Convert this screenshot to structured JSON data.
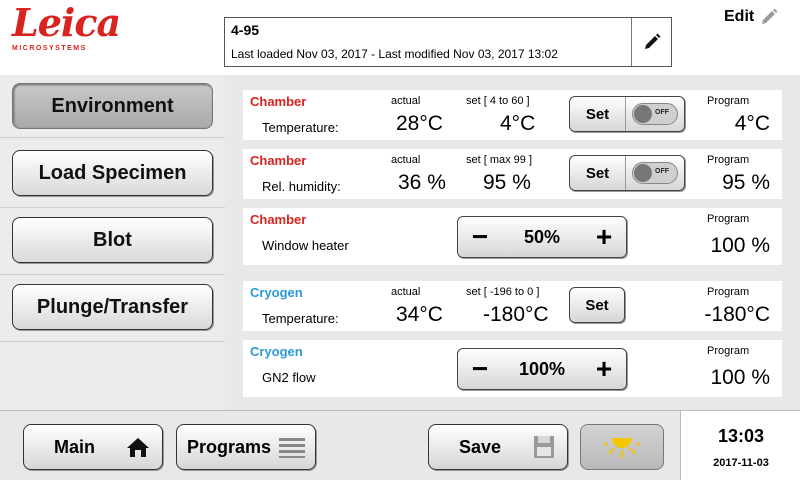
{
  "brand": {
    "name": "Leica",
    "sub": "MICROSYSTEMS",
    "color": "#d9231f"
  },
  "protocol": {
    "name": "4-95",
    "info": "Last loaded Nov 03, 2017 - Last modified Nov 03, 2017 13:02"
  },
  "header": {
    "edit_label": "Edit"
  },
  "nav": {
    "items": [
      {
        "label": "Environment",
        "active": true
      },
      {
        "label": "Load Specimen",
        "active": false
      },
      {
        "label": "Blot",
        "active": false
      },
      {
        "label": "Plunge/Transfer",
        "active": false
      }
    ]
  },
  "colors": {
    "chamber": "#d9231f",
    "cryogen": "#2a9ad6"
  },
  "rows": {
    "chamber_temp": {
      "group": "Chamber",
      "label": "Temperature:",
      "actual_label": "actual",
      "actual": "28°C",
      "set_label": "set [ 4 to 60 ]",
      "set": "4°C",
      "button": "Set",
      "toggle": "OFF",
      "program_label": "Program",
      "program": "4°C"
    },
    "chamber_humidity": {
      "group": "Chamber",
      "label": "Rel. humidity:",
      "actual_label": "actual",
      "actual": "36 %",
      "set_label": "set [ max 99 ]",
      "set": "95 %",
      "button": "Set",
      "toggle": "OFF",
      "program_label": "Program",
      "program": "95 %"
    },
    "window_heater": {
      "group": "Chamber",
      "label": "Window heater",
      "minus": "−",
      "value": "50%",
      "plus": "+",
      "program_label": "Program",
      "program": "100 %"
    },
    "cryogen_temp": {
      "group": "Cryogen",
      "label": "Temperature:",
      "actual_label": "actual",
      "actual": "34°C",
      "set_label": "set [ -196 to 0 ]",
      "set": "-180°C",
      "button": "Set",
      "program_label": "Program",
      "program": "-180°C"
    },
    "gn2_flow": {
      "group": "Cryogen",
      "label": "GN2 flow",
      "minus": "−",
      "value": "100%",
      "plus": "+",
      "program_label": "Program",
      "program": "100 %"
    }
  },
  "bottom": {
    "main_label": "Main",
    "programs_label": "Programs",
    "save_label": "Save",
    "time": "13:03",
    "date": "2017-11-03"
  }
}
